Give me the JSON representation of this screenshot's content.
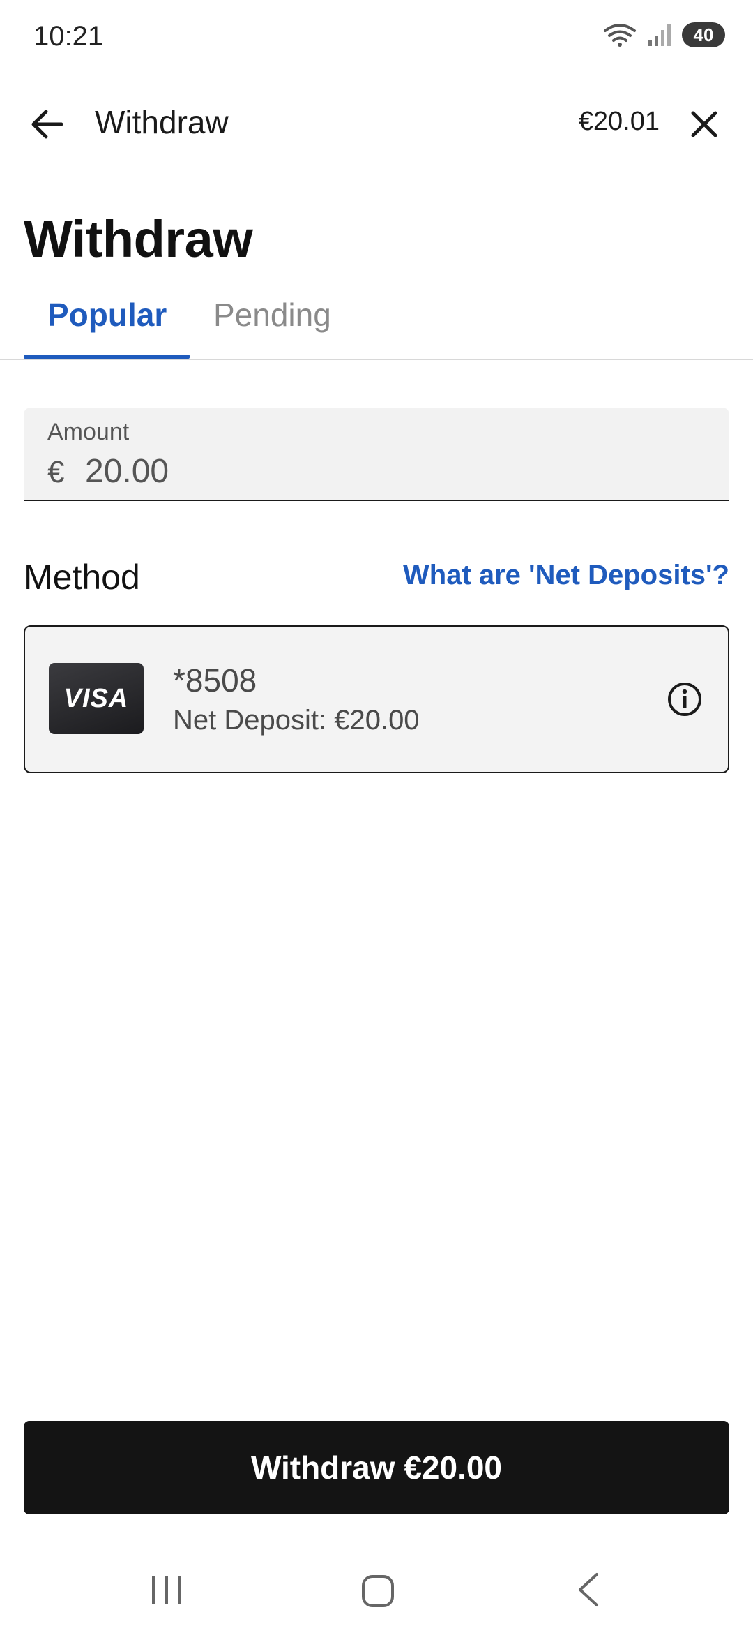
{
  "status_bar": {
    "time": "10:21",
    "battery": "40",
    "icons": [
      "wifi-icon",
      "cell-signal-icon",
      "battery-icon"
    ]
  },
  "app_bar": {
    "title": "Withdraw",
    "balance": "€20.01",
    "icons": [
      "back-arrow-icon",
      "close-icon"
    ]
  },
  "page": {
    "heading": "Withdraw"
  },
  "tabs": [
    {
      "label": "Popular",
      "active": true
    },
    {
      "label": "Pending",
      "active": false
    }
  ],
  "amount": {
    "label": "Amount",
    "currency": "€",
    "value": "20.00"
  },
  "method": {
    "title": "Method",
    "help_link": "What are 'Net Deposits'?",
    "card": {
      "brand": "VISA",
      "number": "*8508",
      "net_deposit": "Net Deposit: €20.00",
      "icon": "info-icon"
    }
  },
  "actions": {
    "withdraw_label": "Withdraw €20.00"
  },
  "nav_bar": {
    "icons": [
      "recents-icon",
      "home-icon",
      "back-icon"
    ]
  },
  "colors": {
    "accent": "#1f5bbd",
    "button_bg": "#141414",
    "field_bg": "#f2f2f2"
  }
}
